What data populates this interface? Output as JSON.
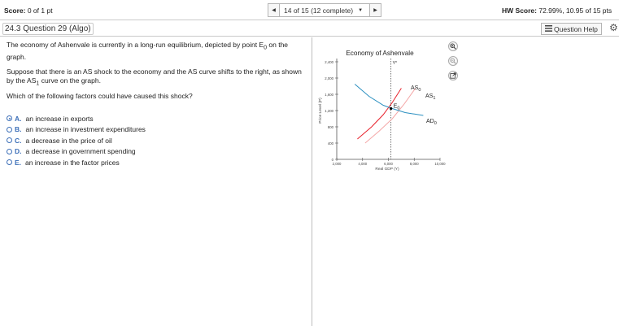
{
  "header": {
    "score_label": "Score:",
    "score_value": "0 of 1 pt",
    "nav_prev": "◀",
    "nav_next": "▶",
    "question_position": "14 of 15 (12 complete)",
    "question_caret": "▼",
    "hw_score_label": "HW Score:",
    "hw_score_value": "72.99%, 10.95 of 15 pts"
  },
  "question_bar": {
    "title": "24.3 Question 29 (Algo)",
    "help_label": "Question Help"
  },
  "question": {
    "p1_a": "The economy of Ashenvale is currently in a long-run equilibrium, depicted by point E",
    "p1_sub": "0",
    "p1_b": " on the graph.",
    "p2_a": "Suppose that there is an AS shock to the economy and the AS curve shifts to the right, as shown by the AS",
    "p2_sub": "1",
    "p2_b": " curve on the graph.",
    "p3": "Which of the following factors could have caused this shock?"
  },
  "options": [
    {
      "letter": "A.",
      "text": "an increase in exports",
      "selected": true
    },
    {
      "letter": "B.",
      "text": "an increase in investment expenditures",
      "selected": false
    },
    {
      "letter": "C.",
      "text": "a decrease in the price of oil",
      "selected": false
    },
    {
      "letter": "D.",
      "text": "a decrease in government spending",
      "selected": false
    },
    {
      "letter": "E.",
      "text": "an increase in the factor prices",
      "selected": false
    }
  ],
  "chart_data": {
    "type": "line",
    "title": "Economy of Ashenvale",
    "xlabel": "Real GDP (Y)",
    "ylabel": "Price Level (P)",
    "xlim": [
      2000,
      10000
    ],
    "ylim": [
      0,
      2400
    ],
    "x_ticks": [
      "2,000",
      "4,000",
      "6,000",
      "8,000",
      "10,000"
    ],
    "y_ticks": [
      "0",
      "400",
      "800",
      "1,200",
      "1,600",
      "2,000",
      "2,400"
    ],
    "potential_output": {
      "label": "Y*",
      "x": 6200
    },
    "series": [
      {
        "name": "AS0",
        "label_main": "AS",
        "label_sub": "0",
        "color": "#e8202a",
        "x": [
          3600,
          4700,
          5600,
          6300,
          7000
        ],
        "y": [
          500,
          800,
          1100,
          1400,
          1750
        ]
      },
      {
        "name": "AS1",
        "label_main": "AS",
        "label_sub": "1",
        "color": "#f4a7a7",
        "x": [
          4200,
          5300,
          6300,
          7200,
          8100
        ],
        "y": [
          400,
          700,
          1000,
          1350,
          1750
        ]
      },
      {
        "name": "AD0",
        "label_main": "AD",
        "label_sub": "0",
        "color": "#2a8fc0",
        "x": [
          3400,
          4500,
          5600,
          6300,
          7300,
          8700
        ],
        "y": [
          1850,
          1550,
          1330,
          1250,
          1150,
          1080
        ]
      }
    ],
    "points": [
      {
        "label_main": "E",
        "label_sub": "0",
        "x": 6200,
        "y": 1250
      }
    ],
    "colors": {
      "as0": "#e8202a",
      "as1": "#f4a7a7",
      "ad0": "#2a8fc0",
      "axis": "#555555"
    }
  },
  "side_icons": [
    "zoom-in-icon",
    "zoom-out-icon",
    "external-link-icon"
  ]
}
